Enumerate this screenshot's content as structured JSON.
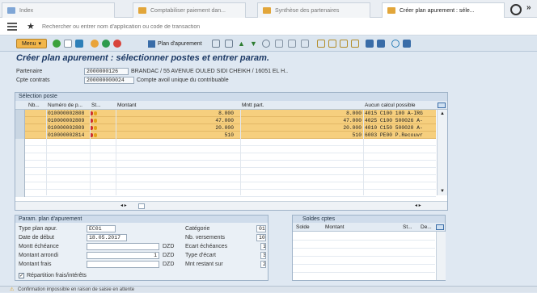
{
  "tabs": [
    {
      "label": "Index",
      "active": false
    },
    {
      "label": "Comptabiliser paiement dan...",
      "active": false
    },
    {
      "label": "Synthèse des partenaires",
      "active": false
    },
    {
      "label": "Créer plan apurement : séle...",
      "active": true
    }
  ],
  "command_bar": {
    "placeholder": "Rechercher ou entrer nom d'application ou code de transaction"
  },
  "toolbar": {
    "menu_label": "Menu",
    "plan_label": "Plan d'apurement"
  },
  "page_title": "Créer plan apurement : sélectionner postes et entrer param.",
  "header": {
    "partenaire_label": "Partenaire",
    "partenaire_value": "2000000126",
    "partenaire_desc": "BRANDAC / 55 AVENUE OULED SIDI CHEIKH / 16051 EL H..",
    "contrat_label": "Cpte contrats",
    "contrat_value": "200000000024",
    "contrat_desc": "Compte avoil unique du contribuable"
  },
  "selection": {
    "title": "Sélection poste",
    "columns": [
      "Nb...",
      "Numéro de p...",
      "St...",
      "Montant",
      "Mntt part.",
      "Aucun calcul possible"
    ],
    "rows": [
      {
        "numero": "010000002808",
        "montant": "8.000",
        "mntt": "8.000",
        "calcul": "4015 C100 100 A-IRG"
      },
      {
        "numero": "010000002809",
        "montant": "47.000",
        "mntt": "47.000",
        "calcul": "4025 C100 500026 A-"
      },
      {
        "numero": "010000002809",
        "montant": "20.000",
        "mntt": "20.000",
        "calcul": "4010 C150 500020 A-"
      },
      {
        "numero": "010000002814",
        "montant": "510",
        "mntt": "510",
        "calcul": "6003 PE00 P.Recouvr"
      }
    ]
  },
  "params": {
    "title": "Param. plan d'apurement",
    "type_label": "Type plan apur.",
    "type_value": "EC01",
    "date_label": "Date de début",
    "date_value": "18.05.2017",
    "echeance_label": "Montt échéance",
    "echeance_value": "",
    "echeance_unit": "DZD",
    "arrondi_label": "Montant arrondi",
    "arrondi_value": "1",
    "arrondi_unit": "DZD",
    "frais_label": "Montant frais",
    "frais_value": "",
    "frais_unit": "DZD",
    "categorie_label": "Catégorie",
    "categorie_value": "01",
    "versements_label": "Nb. versements",
    "versements_value": "10",
    "ecart_label": "Ecart échéances",
    "ecart_value": "1",
    "type_ecart_label": "Type d'écart",
    "type_ecart_value": "3",
    "restant_label": "Mnt restant sur",
    "restant_value": "2",
    "repartition_label": "Répartition frais/intérêts"
  },
  "soldes": {
    "title": "Soldes cptes",
    "columns": [
      "Solde",
      "Montant",
      "St...",
      "De..."
    ]
  },
  "status": {
    "message": "Confirmation impossible en raison de saisie en attente"
  },
  "colors": {
    "row_highlight": "#f6cf7e",
    "title_blue": "#1d3a66",
    "status_red": "#d0312d",
    "status_amber": "#e3a21a"
  }
}
